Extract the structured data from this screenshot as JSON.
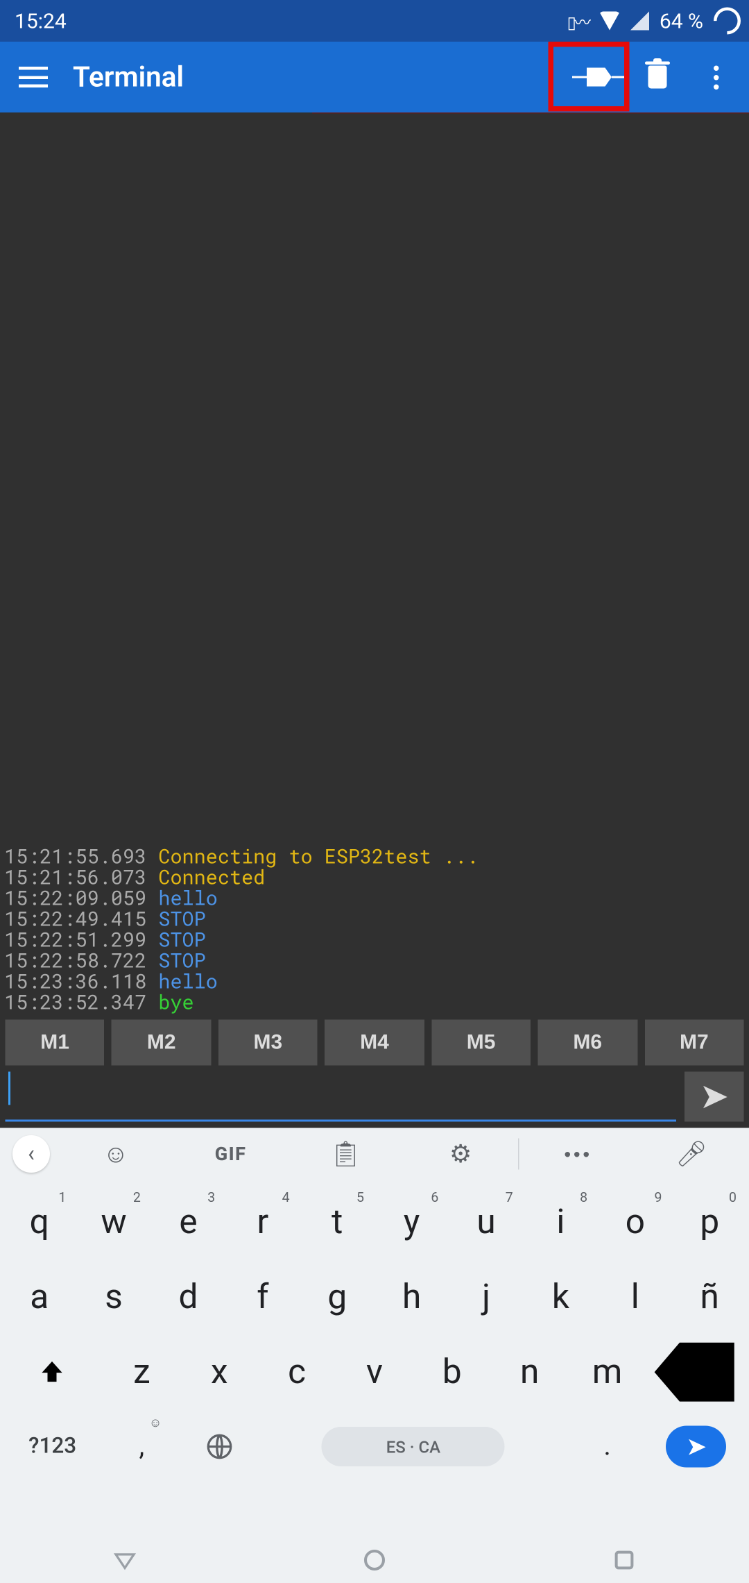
{
  "status": {
    "time": "15:24",
    "battery": "64 %"
  },
  "appbar": {
    "title": "Terminal"
  },
  "log": [
    {
      "ts": "15:21:55.693",
      "msg": "Connecting to ESP32test ...",
      "cls": "c-yellow"
    },
    {
      "ts": "15:21:56.073",
      "msg": "Connected",
      "cls": "c-yellow"
    },
    {
      "ts": "15:22:09.059",
      "msg": "hello",
      "cls": "c-blue"
    },
    {
      "ts": "15:22:49.415",
      "msg": "STOP",
      "cls": "c-blue"
    },
    {
      "ts": "15:22:51.299",
      "msg": "STOP",
      "cls": "c-blue"
    },
    {
      "ts": "15:22:58.722",
      "msg": "STOP",
      "cls": "c-blue"
    },
    {
      "ts": "15:23:36.118",
      "msg": "hello",
      "cls": "c-blue"
    },
    {
      "ts": "15:23:52.347",
      "msg": "bye",
      "cls": "c-green"
    }
  ],
  "macros": [
    "M1",
    "M2",
    "M3",
    "M4",
    "M5",
    "M6",
    "M7"
  ],
  "input": {
    "value": ""
  },
  "keyboard": {
    "gif": "GIF",
    "row1": [
      {
        "k": "q",
        "n": "1"
      },
      {
        "k": "w",
        "n": "2"
      },
      {
        "k": "e",
        "n": "3"
      },
      {
        "k": "r",
        "n": "4"
      },
      {
        "k": "t",
        "n": "5"
      },
      {
        "k": "y",
        "n": "6"
      },
      {
        "k": "u",
        "n": "7"
      },
      {
        "k": "i",
        "n": "8"
      },
      {
        "k": "o",
        "n": "9"
      },
      {
        "k": "p",
        "n": "0"
      }
    ],
    "row2": [
      "a",
      "s",
      "d",
      "f",
      "g",
      "h",
      "j",
      "k",
      "l",
      "ñ"
    ],
    "row3": [
      "z",
      "x",
      "c",
      "v",
      "b",
      "n",
      "m"
    ],
    "symLabel": "?123",
    "comma": ",",
    "period": ".",
    "space": "ES · CA"
  }
}
